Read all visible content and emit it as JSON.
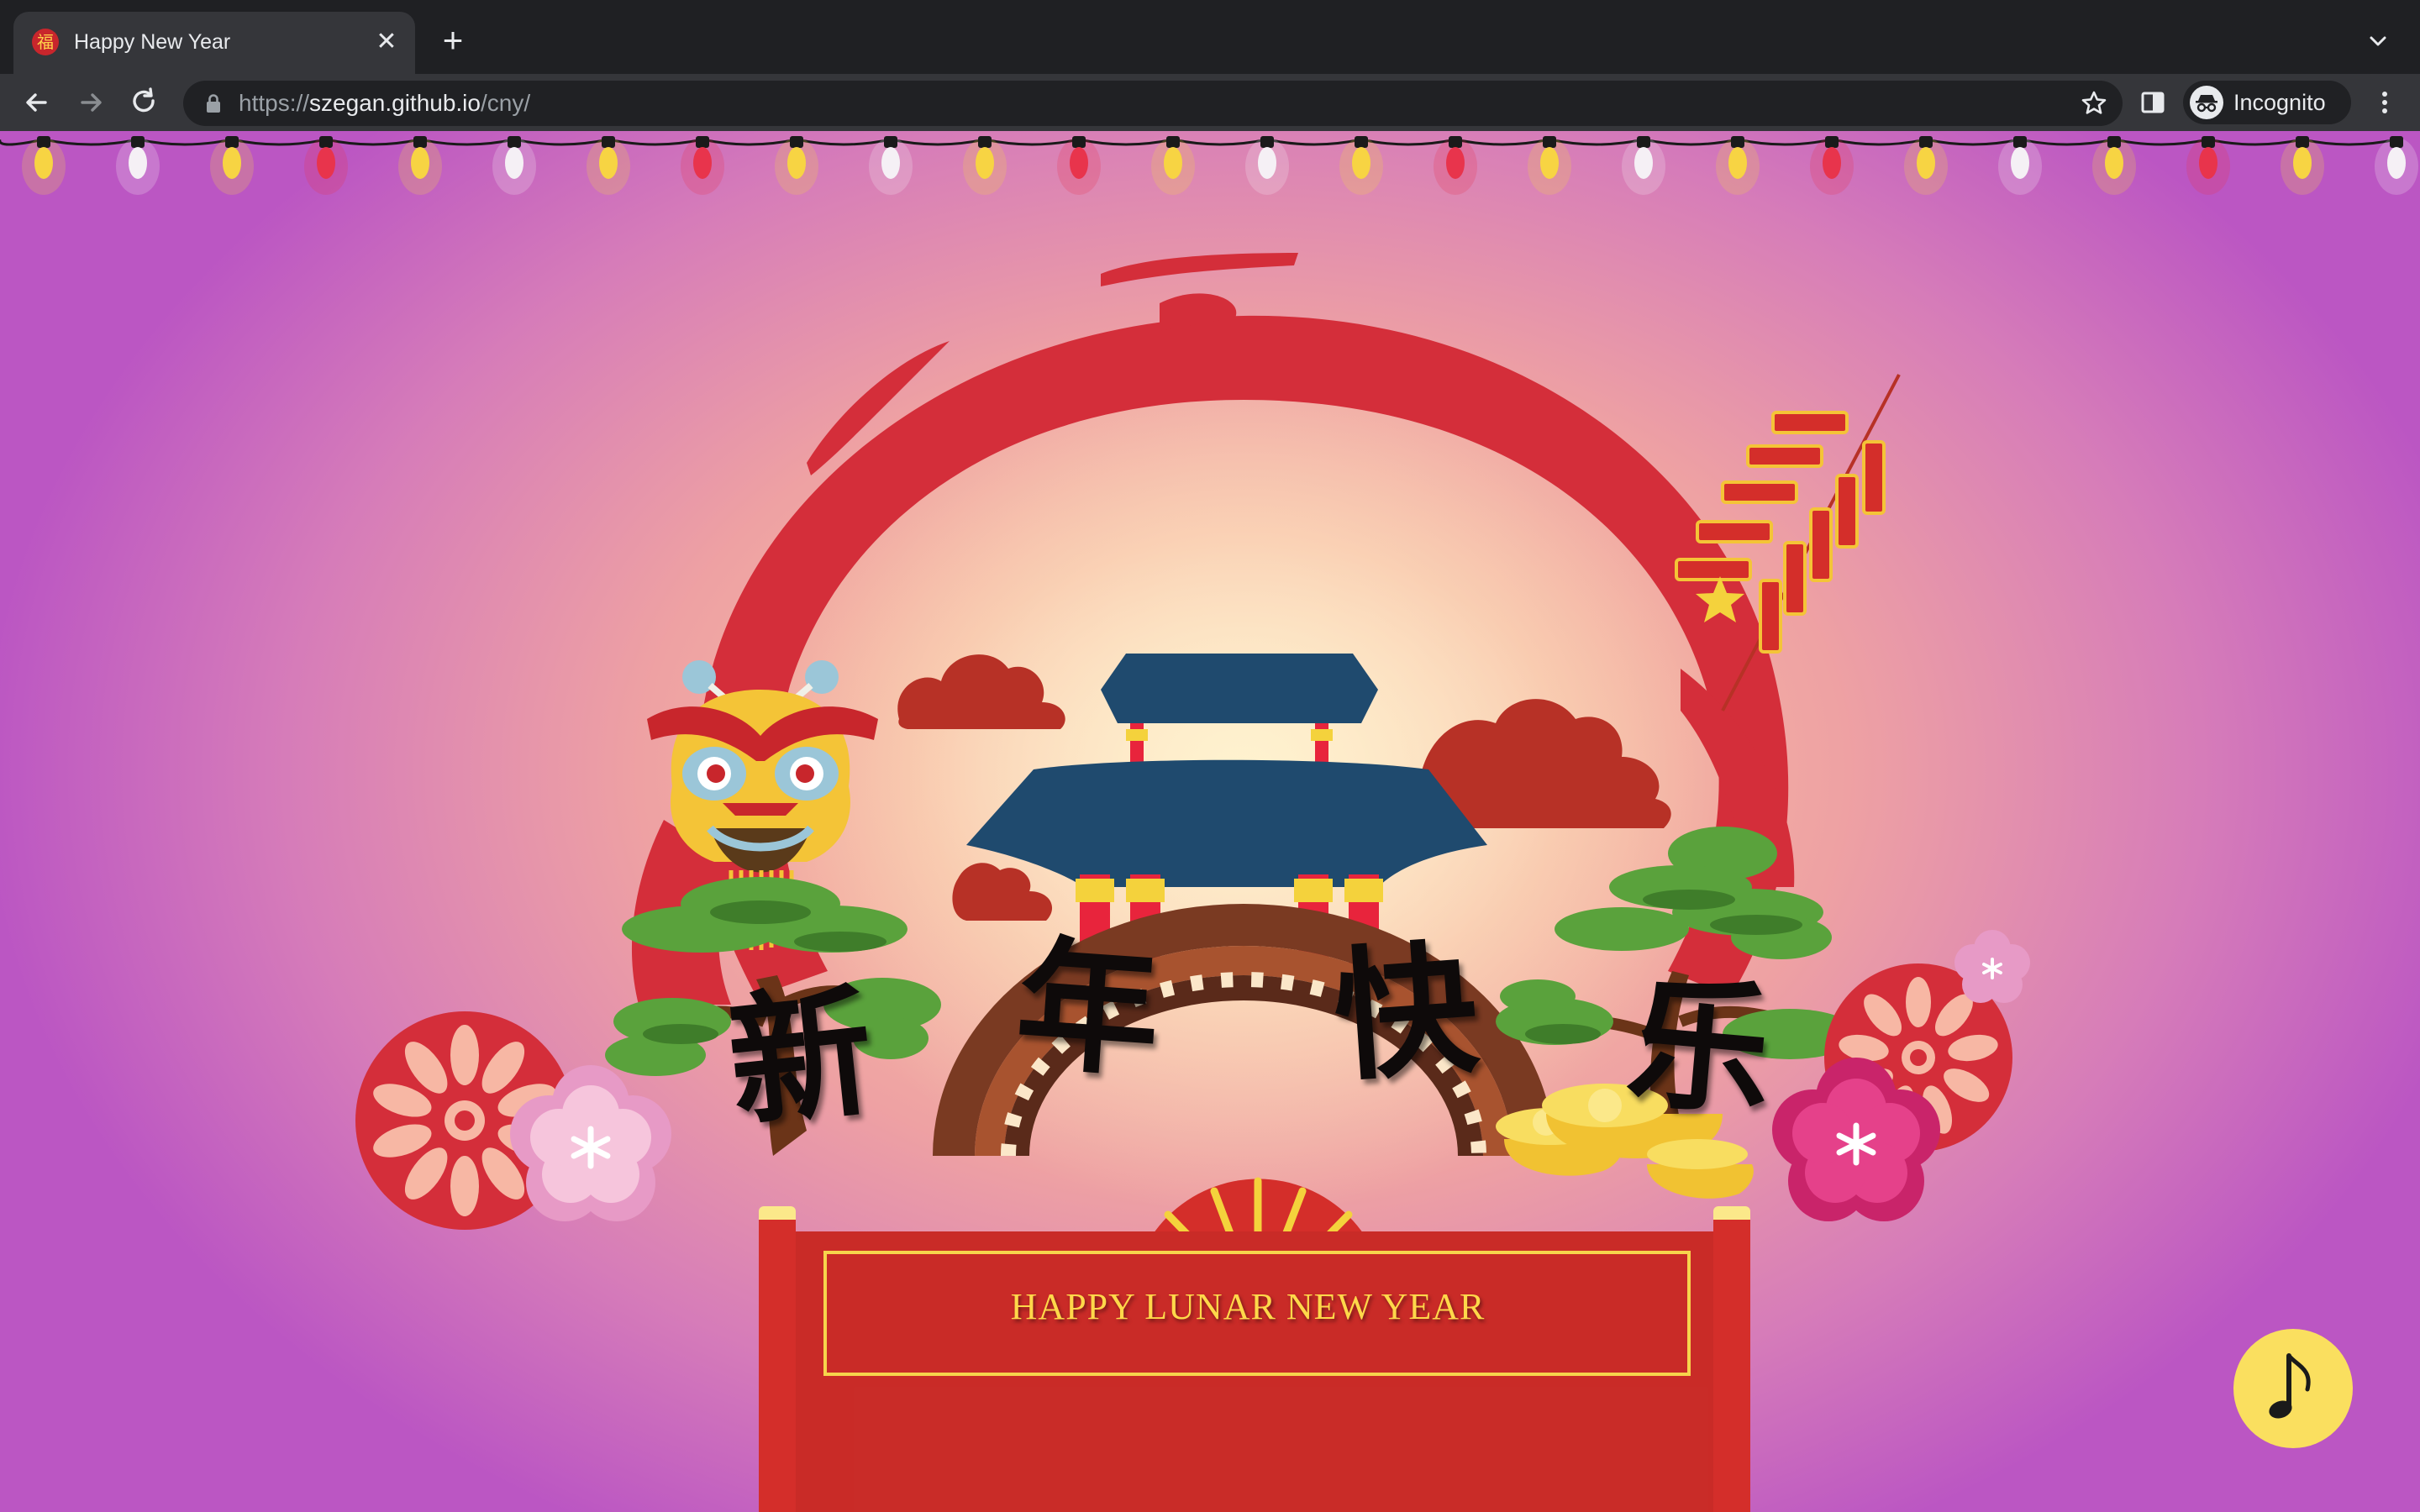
{
  "browser": {
    "tab_title": "Happy New Year",
    "tab_favicon_glyph": "福",
    "url_scheme": "https://",
    "url_host": "szegan.github.io",
    "url_path": "/cny/",
    "profile_label": "Incognito",
    "icons": {
      "tab_close": "close-icon",
      "new_tab": "plus-icon",
      "back": "arrow-left-icon",
      "forward": "arrow-right-icon",
      "reload": "reload-icon",
      "lock": "lock-icon",
      "bookmark": "star-icon",
      "side_panel": "side-panel-icon",
      "menu": "kebab-menu-icon"
    }
  },
  "page": {
    "greeting_chars": [
      "新",
      "年",
      "快",
      "乐"
    ],
    "banner_text": "HAPPY LUNAR NEW YEAR",
    "music_button_icon": "music-note-icon",
    "colors": {
      "banner_red": "#d42e2a",
      "banner_gold": "#f7d44c",
      "brush_red": "#d42e3a",
      "roof_blue": "#1f4a6e",
      "bridge_brown": "#7a3a22",
      "tree_green": "#5aa23c",
      "music_button_yellow": "#fadf5f"
    }
  }
}
